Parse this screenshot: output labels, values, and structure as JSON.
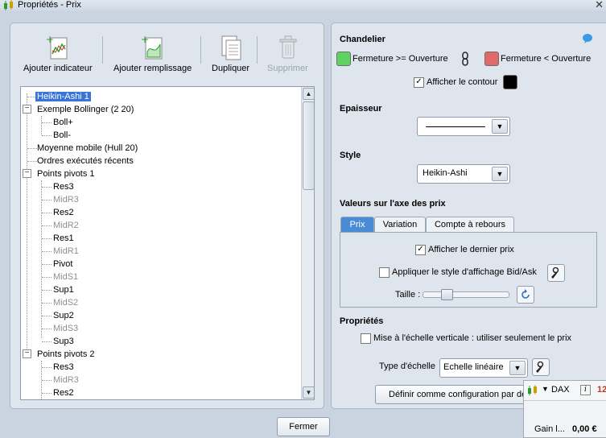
{
  "window": {
    "title": "Propriétés - Prix"
  },
  "toolbar": {
    "add_indicator": "Ajouter indicateur",
    "add_fill": "Ajouter remplissage",
    "duplicate": "Dupliquer",
    "delete": "Supprimer"
  },
  "tree": {
    "items": [
      "Heikin-Ashi 1",
      "Exemple Bollinger (2 20)",
      "Boll+",
      "Boll-",
      "Moyenne mobile (Hull 20)",
      "Ordres exécutés récents",
      "Points pivots 1",
      "Res3",
      "MidR3",
      "Res2",
      "MidR2",
      "Res1",
      "MidR1",
      "Pivot",
      "MidS1",
      "Sup1",
      "MidS2",
      "Sup2",
      "MidS3",
      "Sup3",
      "Points pivots 2",
      "Res3",
      "MidR3",
      "Res2"
    ],
    "expander_symbol": "−"
  },
  "chandelier": {
    "title": "Chandelier",
    "up_label": "Fermeture >= Ouverture",
    "down_label": "Fermeture  < Ouverture",
    "up_color": "#5fd35f",
    "down_color": "#e06a6a",
    "outline_label": "Afficher le contour",
    "outline_checked": "✓",
    "outline_color": "#000000"
  },
  "epaisseur": {
    "title": "Epaisseur"
  },
  "style": {
    "title": "Style",
    "value": "Heikin-Ashi"
  },
  "axis_values": {
    "title": "Valeurs sur l'axe des prix",
    "tabs": [
      "Prix",
      "Variation",
      "Compte à rebours"
    ],
    "show_last_price": "Afficher le dernier prix",
    "show_last_price_checked": "✓",
    "bid_ask_label": "Appliquer le style d'affichage Bid/Ask",
    "size_label": "Taille :",
    "size_level": 0.25
  },
  "properties": {
    "title": "Propriétés",
    "scale_label": "Mise à l'échelle verticale : utiliser seulement le prix",
    "scale_type_label": "Type d'échelle",
    "scale_type_value": "Echelle linéaire",
    "default_button": "Définir comme configuration par dé"
  },
  "footer": {
    "close": "Fermer"
  },
  "dax_popup": {
    "symbol": "DAX",
    "info": "i",
    "value_partial": "12",
    "gain_label": "Gain l...",
    "gain_value": "0,00 €"
  },
  "colors": {
    "accent": "#4a8bd6",
    "selection": "#3875d7"
  }
}
